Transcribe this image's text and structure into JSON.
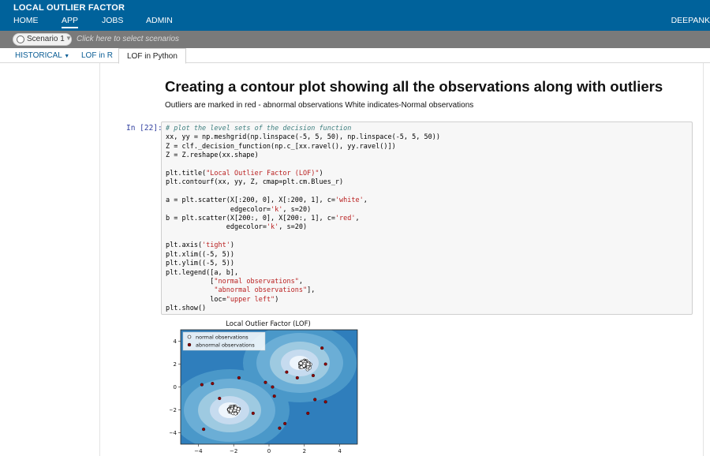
{
  "app": {
    "title": "LOCAL OUTLIER FACTOR"
  },
  "nav": {
    "home": "HOME",
    "app": "APP",
    "jobs": "JOBS",
    "admin": "ADMIN",
    "user": "DEEPANK"
  },
  "scenario": {
    "selected": "Scenario 1",
    "hint": "Click here to select scenarios"
  },
  "tabs": {
    "historical": "HISTORICAL",
    "lof_r": "LOF in R",
    "lof_python": "LOF in Python"
  },
  "page": {
    "heading": "Creating a contour plot showing all the observations along with outliers",
    "subtext": "Outliers are marked in red - abnormal observations White indicates-Normal observations"
  },
  "cell": {
    "prompt": "In [22]:"
  },
  "colors": {
    "header": "#00629b",
    "scenario_bar": "#7a7a7a",
    "outlier": "#8b0000",
    "normal": "#ffffff"
  },
  "chart_data": {
    "type": "scatter",
    "title": "Local Outlier Factor (LOF)",
    "xlim": [
      -5,
      5
    ],
    "ylim": [
      -5,
      5
    ],
    "xticks": [
      -4,
      -2,
      0,
      2,
      4
    ],
    "yticks": [
      -4,
      -2,
      0,
      2,
      4
    ],
    "legend": {
      "placement": "upper left",
      "entries": [
        "normal observations",
        "abnormal observations"
      ]
    },
    "background": "contourf, Blues_r colormap",
    "clusters": [
      {
        "name": "normal observations",
        "center": [
          2,
          2
        ]
      },
      {
        "name": "normal observations",
        "center": [
          -2,
          -2
        ]
      }
    ],
    "series": [
      {
        "name": "abnormal observations",
        "color": "#8b0000",
        "points": [
          [
            -3.2,
            0.3
          ],
          [
            -3.8,
            0.2
          ],
          [
            -0.2,
            0.4
          ],
          [
            1.0,
            1.3
          ],
          [
            3.0,
            3.4
          ],
          [
            3.2,
            2.0
          ],
          [
            1.6,
            0.8
          ],
          [
            2.5,
            1.0
          ],
          [
            0.2,
            0.0
          ],
          [
            -1.7,
            0.8
          ],
          [
            0.3,
            -0.8
          ],
          [
            2.6,
            -1.1
          ],
          [
            3.2,
            -1.3
          ],
          [
            2.2,
            -2.3
          ],
          [
            -2.8,
            -1.0
          ],
          [
            -0.9,
            -2.3
          ],
          [
            0.6,
            -3.6
          ],
          [
            0.9,
            -3.2
          ],
          [
            -3.7,
            -3.7
          ]
        ]
      }
    ]
  }
}
